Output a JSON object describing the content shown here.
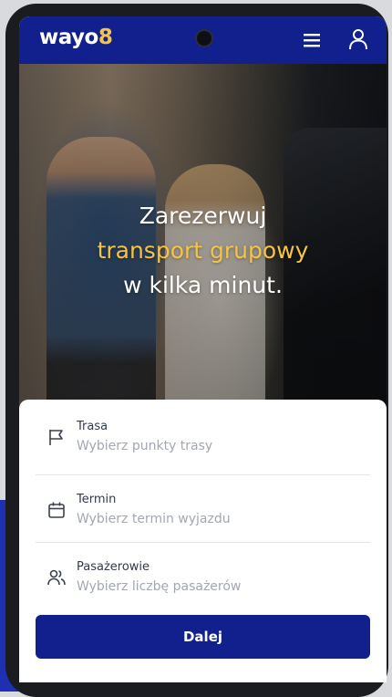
{
  "header": {
    "logo_text": "wayo",
    "logo_accent": "8"
  },
  "hero": {
    "line1": "Zarezerwuj",
    "line2": "transport grupowy",
    "line3": "w kilka minut."
  },
  "form": {
    "fields": [
      {
        "label": "Trasa",
        "placeholder": "Wybierz punkty trasy",
        "icon": "flag-icon"
      },
      {
        "label": "Termin",
        "placeholder": "Wybierz termin wyjazdu",
        "icon": "calendar-icon"
      },
      {
        "label": "Pasażerowie",
        "placeholder": "Wybierz liczbę pasażerów",
        "icon": "users-icon"
      }
    ],
    "submit_label": "Dalej"
  },
  "colors": {
    "brand_blue": "#11208c",
    "accent_yellow": "#f6c445"
  }
}
